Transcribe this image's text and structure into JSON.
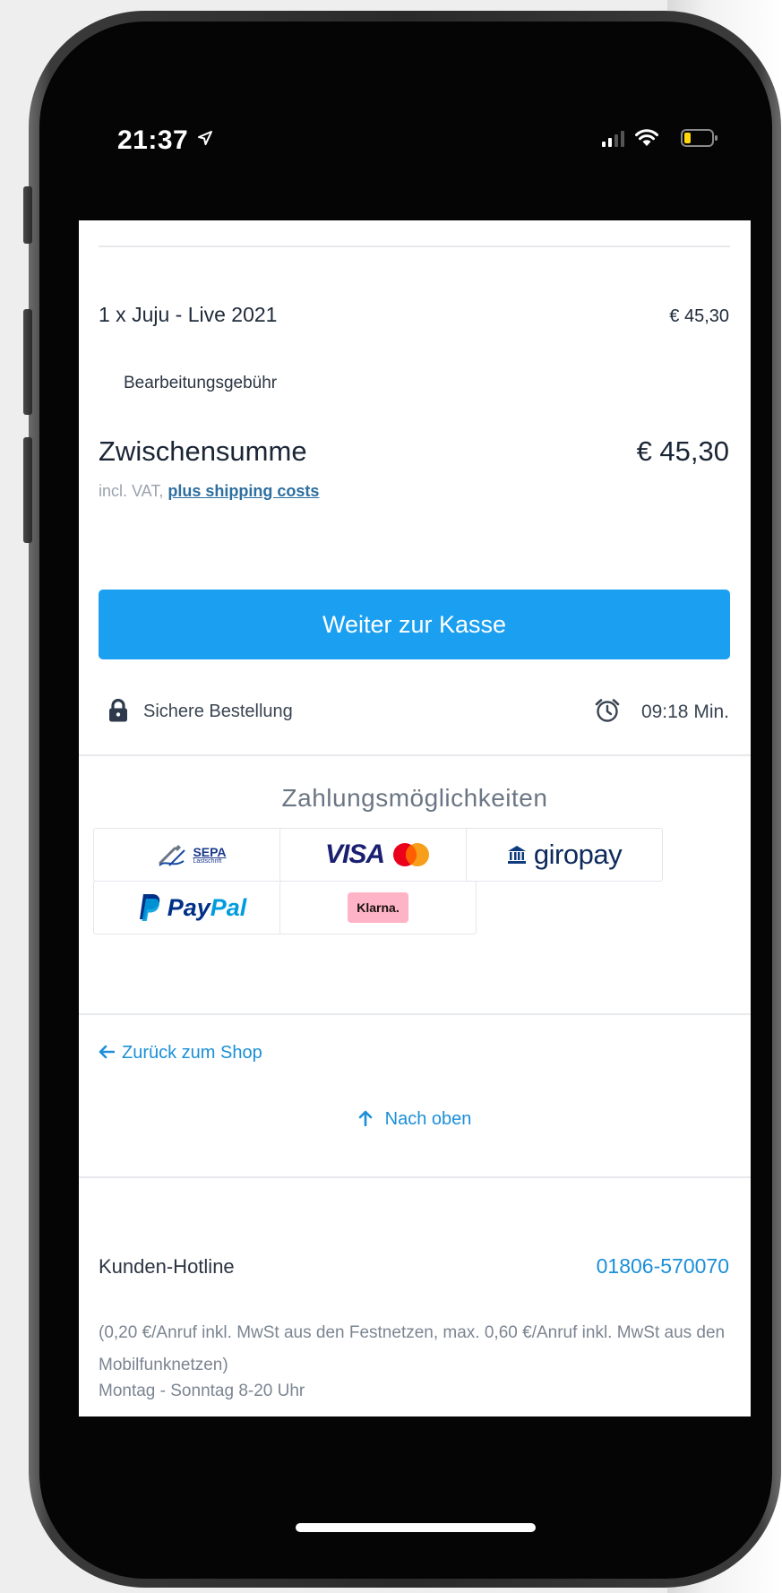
{
  "status_bar": {
    "time": "21:37",
    "icons": [
      "location-arrow-icon",
      "signal-icon",
      "wifi-icon",
      "battery-icon"
    ]
  },
  "cart": {
    "item_name": "1 x Juju - Live 2021",
    "item_price": "€ 45,30",
    "fee_label": "Bearbeitungsgebühr",
    "subtotal_label": "Zwischensumme",
    "subtotal_value": "€ 45,30",
    "vat_prefix": "incl. VAT,",
    "shipping_link": "plus shipping costs"
  },
  "checkout": {
    "button_label": "Weiter zur Kasse",
    "secure_label": "Sichere Bestellung",
    "timer": "09:18 Min."
  },
  "payment": {
    "title": "Zahlungsmöglichkeiten",
    "methods": {
      "sepa_main": "SEPA",
      "sepa_sub": "Lastschrift",
      "visa": "VISA",
      "giropay": "giropay",
      "paypal_pay": "Pay",
      "paypal_pal": "Pal",
      "klarna": "Klarna."
    }
  },
  "navigation": {
    "back_to_shop": "Zurück zum Shop",
    "to_top": "Nach oben"
  },
  "hotline": {
    "label": "Kunden-Hotline",
    "number": "01806-570070",
    "note": "(0,20 €/Anruf inkl. MwSt aus den Festnetzen, max. 0,60 €/Anruf inkl. MwSt aus den Mobilfunknetzen)",
    "hours": "Montag - Sonntag 8-20 Uhr"
  },
  "colors": {
    "accent": "#1b9ff0",
    "link": "#1b8fd8",
    "visa_blue": "#1a1f71",
    "mc_red": "#eb001b",
    "mc_orange": "#f79e1b",
    "paypal_dark": "#003087",
    "paypal_light": "#009cde",
    "klarna_pink": "#ffb3c7"
  }
}
